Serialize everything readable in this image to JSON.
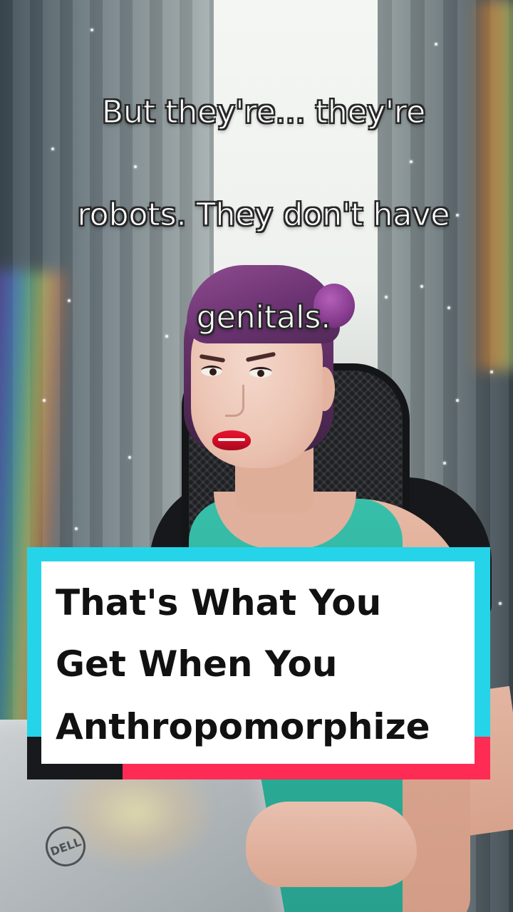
{
  "caption": {
    "lines": [
      "But they're... they're",
      "robots. They don't have",
      "genitals."
    ]
  },
  "title_card": {
    "lines": [
      "That's What You",
      "Get When You",
      "Anthropomorphize"
    ],
    "colors": {
      "card": "#ffffff",
      "text": "#111111",
      "accent_cyan": "#25d4e9",
      "accent_pink": "#fe2c55",
      "accent_dark": "#18191c"
    }
  },
  "laptop": {
    "logo_text": "DELL"
  }
}
